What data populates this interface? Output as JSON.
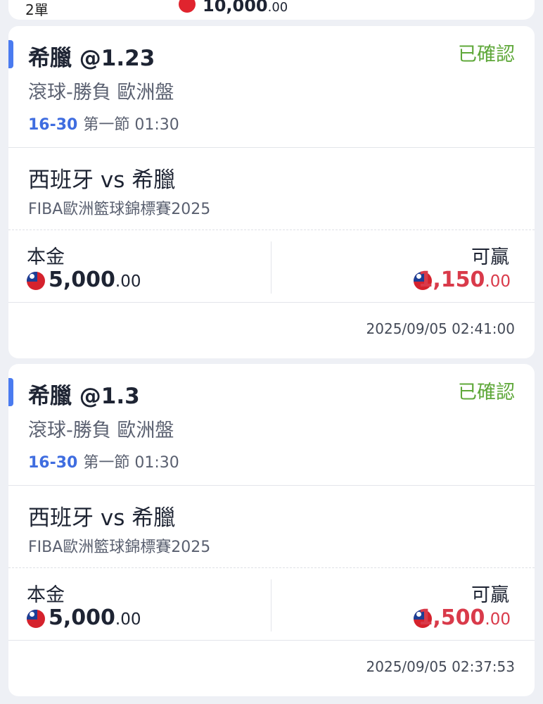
{
  "top_summary": {
    "count": "2單",
    "amount_int": "10,000",
    "amount_dec": ".00"
  },
  "bets": [
    {
      "selection": "希臘 @1.23",
      "status": "已確認",
      "market": "滾球-勝負 歐洲盤",
      "score": "16-30",
      "period": "第一節 01:30",
      "teams": "西班牙 vs 希臘",
      "league": "FIBA歐洲籃球錦標賽2025",
      "stake_label": "本金",
      "stake_int": "5,000",
      "stake_dec": ".00",
      "win_label": "可贏",
      "win_int": "1,150",
      "win_dec": ".00",
      "timestamp": "2025/09/05 02:41:00"
    },
    {
      "selection": "希臘 @1.3",
      "status": "已確認",
      "market": "滾球-勝負 歐洲盤",
      "score": "16-30",
      "period": "第一節 01:30",
      "teams": "西班牙 vs 希臘",
      "league": "FIBA歐洲籃球錦標賽2025",
      "stake_label": "本金",
      "stake_int": "5,000",
      "stake_dec": ".00",
      "win_label": "可贏",
      "win_int": "1,500",
      "win_dec": ".00",
      "timestamp": "2025/09/05 02:37:53"
    }
  ],
  "icons": {
    "currency_flag": "taiwan-flag-icon"
  },
  "colors": {
    "status_confirmed": "#5fa83a",
    "win_amount": "#d93a4a",
    "score_highlight": "#3f6de0",
    "accent_bar": "#4a7bf0",
    "background": "#eef0f5"
  }
}
